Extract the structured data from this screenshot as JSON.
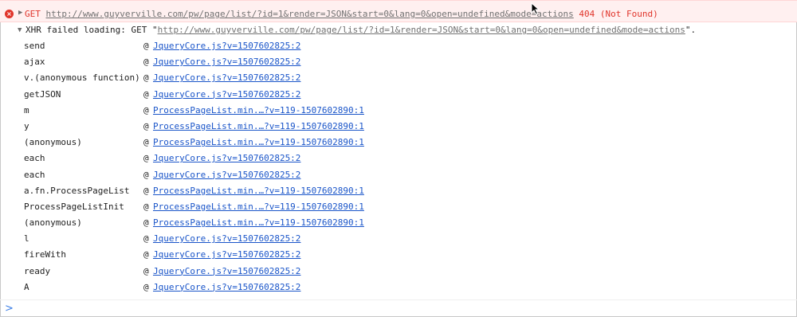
{
  "error": {
    "method": "GET",
    "url": "http://www.guyverville.com/pw/page/list/?id=1&render=JSON&start=0&lang=0&open=undefined&mode=actions",
    "status": "404 (Not Found)"
  },
  "xhr": {
    "prefix": "XHR failed loading: GET \"",
    "url": "http://www.guyverville.com/pw/page/list/?id=1&render=JSON&start=0&lang=0&open=undefined&mode=actions",
    "suffix": "\"."
  },
  "stack": [
    {
      "fn": "send",
      "at": "@",
      "src": "JqueryCore.js?v=1507602825:2"
    },
    {
      "fn": "ajax",
      "at": "@",
      "src": "JqueryCore.js?v=1507602825:2"
    },
    {
      "fn": "v.(anonymous function)",
      "at": "@",
      "src": "JqueryCore.js?v=1507602825:2"
    },
    {
      "fn": "getJSON",
      "at": "@",
      "src": "JqueryCore.js?v=1507602825:2"
    },
    {
      "fn": "m",
      "at": "@",
      "src": "ProcessPageList.min.…?v=119-1507602890:1"
    },
    {
      "fn": "y",
      "at": "@",
      "src": "ProcessPageList.min.…?v=119-1507602890:1"
    },
    {
      "fn": "(anonymous)",
      "at": "@",
      "src": "ProcessPageList.min.…?v=119-1507602890:1"
    },
    {
      "fn": "each",
      "at": "@",
      "src": "JqueryCore.js?v=1507602825:2"
    },
    {
      "fn": "each",
      "at": "@",
      "src": "JqueryCore.js?v=1507602825:2"
    },
    {
      "fn": "a.fn.ProcessPageList",
      "at": "@",
      "src": "ProcessPageList.min.…?v=119-1507602890:1"
    },
    {
      "fn": "ProcessPageListInit",
      "at": "@",
      "src": "ProcessPageList.min.…?v=119-1507602890:1"
    },
    {
      "fn": "(anonymous)",
      "at": "@",
      "src": "ProcessPageList.min.…?v=119-1507602890:1"
    },
    {
      "fn": "l",
      "at": "@",
      "src": "JqueryCore.js?v=1507602825:2"
    },
    {
      "fn": "fireWith",
      "at": "@",
      "src": "JqueryCore.js?v=1507602825:2"
    },
    {
      "fn": "ready",
      "at": "@",
      "src": "JqueryCore.js?v=1507602825:2"
    },
    {
      "fn": "A",
      "at": "@",
      "src": "JqueryCore.js?v=1507602825:2"
    }
  ],
  "prompt": {
    "symbol": ">"
  }
}
